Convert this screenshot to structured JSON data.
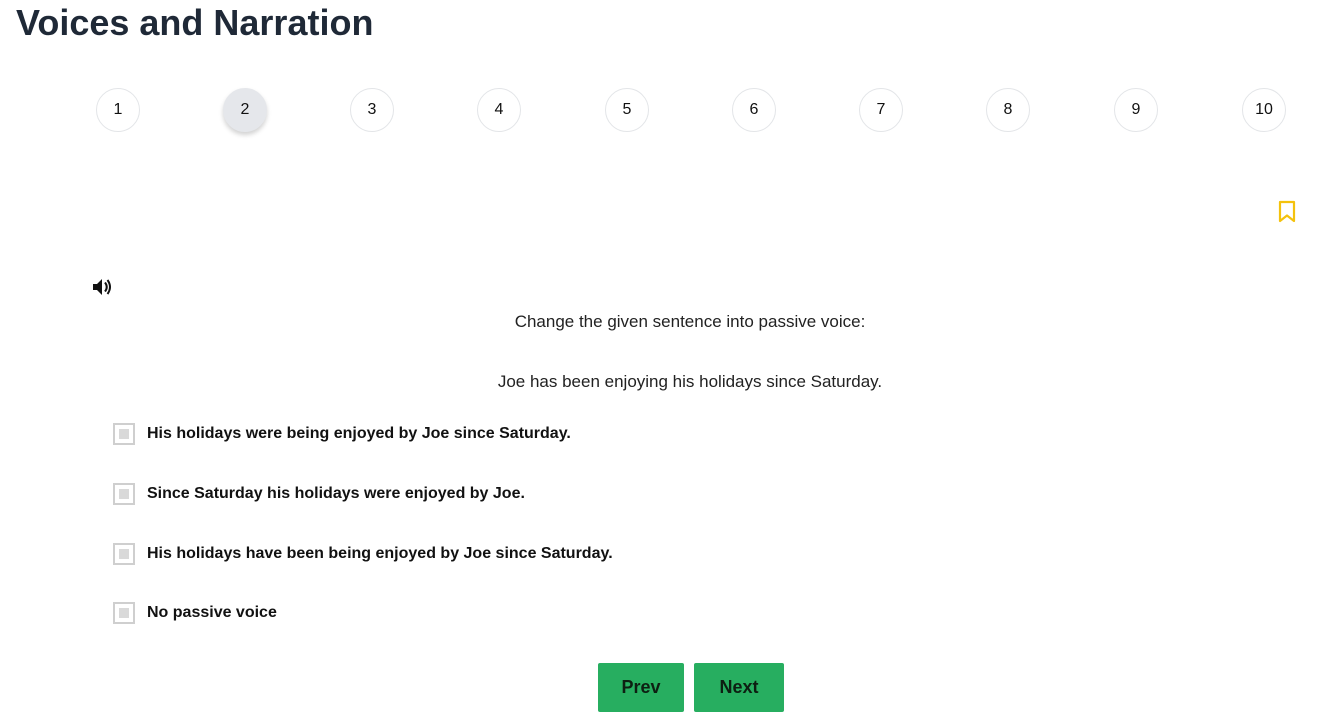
{
  "page": {
    "title": "Voices and Narration"
  },
  "steps": [
    "1",
    "2",
    "3",
    "4",
    "5",
    "6",
    "7",
    "8",
    "9",
    "10"
  ],
  "current_step": "2",
  "question": {
    "instruction": "Change the given sentence into passive voice:",
    "sentence": "Joe has been enjoying his holidays since Saturday."
  },
  "options": [
    {
      "label": "His holidays were being enjoyed by Joe since Saturday.",
      "checked": false
    },
    {
      "label": "Since Saturday his holidays were enjoyed by Joe.",
      "checked": false
    },
    {
      "label": "His holidays have been being enjoyed by Joe since Saturday.",
      "checked": false
    },
    {
      "label": "No passive voice",
      "checked": false
    }
  ],
  "buttons": {
    "prev_label": "Prev",
    "next_label": "Next"
  },
  "icons": {
    "bookmark": "bookmark-icon",
    "audio": "speaker-icon"
  },
  "colors": {
    "accent_button": "#27ae60",
    "bookmark": "#f4c20d",
    "active_step_bg": "#e5e7eb"
  }
}
